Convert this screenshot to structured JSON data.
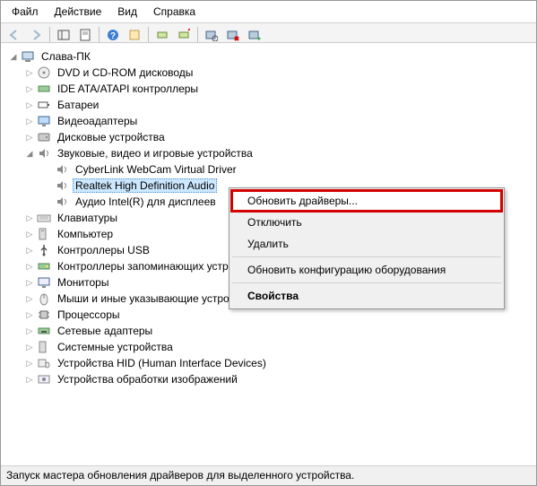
{
  "menu": {
    "file": "Файл",
    "action": "Действие",
    "view": "Вид",
    "help": "Справка"
  },
  "toolbar_icons": [
    "back",
    "forward",
    "up",
    "sep",
    "properties",
    "console",
    "sep",
    "help",
    "sep",
    "refresh",
    "export",
    "sep",
    "scan",
    "remove",
    "update"
  ],
  "tree": {
    "root": "Слава-ПК",
    "categories": [
      {
        "label": "DVD и CD-ROM дисководы",
        "exp": "closed"
      },
      {
        "label": "IDE ATA/ATAPI контроллеры",
        "exp": "closed"
      },
      {
        "label": "Батареи",
        "exp": "closed"
      },
      {
        "label": "Видеоадаптеры",
        "exp": "closed"
      },
      {
        "label": "Дисковые устройства",
        "exp": "closed"
      },
      {
        "label": "Звуковые, видео и игровые устройства",
        "exp": "open",
        "children": [
          {
            "label": "CyberLink WebCam Virtual Driver"
          },
          {
            "label": "Realtek High Definition Audio",
            "selected": true
          },
          {
            "label": "Аудио Intel(R) для дисплеев"
          }
        ]
      },
      {
        "label": "Клавиатуры",
        "exp": "closed"
      },
      {
        "label": "Компьютер",
        "exp": "closed"
      },
      {
        "label": "Контроллеры USB",
        "exp": "closed"
      },
      {
        "label": "Контроллеры запоминающих устройств",
        "exp": "closed"
      },
      {
        "label": "Мониторы",
        "exp": "closed"
      },
      {
        "label": "Мыши и иные указывающие устройства",
        "exp": "closed"
      },
      {
        "label": "Процессоры",
        "exp": "closed"
      },
      {
        "label": "Сетевые адаптеры",
        "exp": "closed"
      },
      {
        "label": "Системные устройства",
        "exp": "closed"
      },
      {
        "label": "Устройства HID (Human Interface Devices)",
        "exp": "closed"
      },
      {
        "label": "Устройства обработки изображений",
        "exp": "closed"
      }
    ]
  },
  "context_menu": {
    "update_drivers": "Обновить драйверы...",
    "disable": "Отключить",
    "remove": "Удалить",
    "scan": "Обновить конфигурацию оборудования",
    "properties": "Свойства"
  },
  "statusbar": "Запуск мастера обновления драйверов для выделенного устройства."
}
